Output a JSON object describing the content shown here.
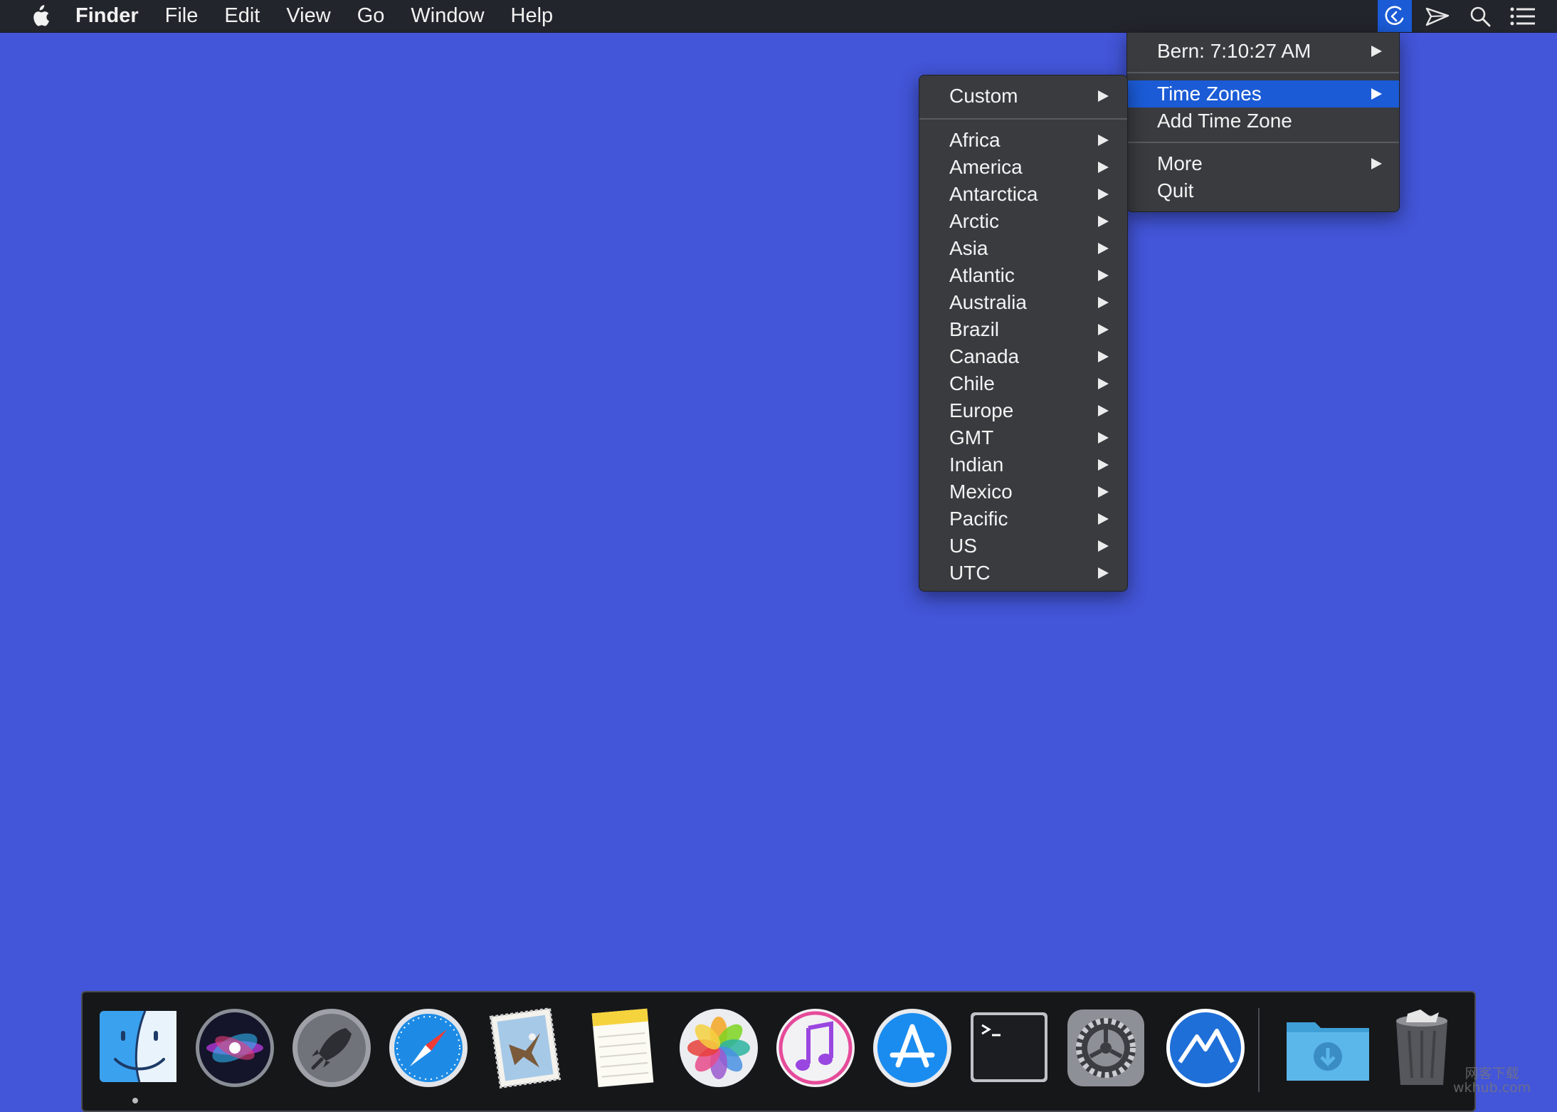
{
  "menubar": {
    "app_name": "Finder",
    "items": [
      "File",
      "Edit",
      "View",
      "Go",
      "Window",
      "Help"
    ],
    "status_icons": [
      "clock-menu-icon",
      "paper-plane-icon",
      "spotlight-search-icon",
      "notification-center-icon"
    ]
  },
  "clock_menu": {
    "header": "Bern: 7:10:27 AM",
    "time_zones": "Time Zones",
    "add_time_zone": "Add Time Zone",
    "more": "More",
    "quit": "Quit"
  },
  "time_zones_menu": {
    "custom": "Custom",
    "regions": [
      "Africa",
      "America",
      "Antarctica",
      "Arctic",
      "Asia",
      "Atlantic",
      "Australia",
      "Brazil",
      "Canada",
      "Chile",
      "Europe",
      "GMT",
      "Indian",
      "Mexico",
      "Pacific",
      "US",
      "UTC"
    ]
  },
  "dock": {
    "apps": [
      "finder-icon",
      "siri-icon",
      "launchpad-icon",
      "safari-icon",
      "mail-icon",
      "notes-icon",
      "photos-icon",
      "itunes-icon",
      "app-store-icon",
      "terminal-icon",
      "system-preferences-icon",
      "mountain-app-icon",
      "downloads-folder-icon",
      "trash-icon"
    ]
  },
  "watermark": {
    "line1": "网客下载",
    "line2": "wkhub.com"
  },
  "colors": {
    "desktop": "#4355d8",
    "menubar": "#23252c",
    "menu_bg": "#3a3b3f",
    "highlight": "#1b5bd6"
  }
}
